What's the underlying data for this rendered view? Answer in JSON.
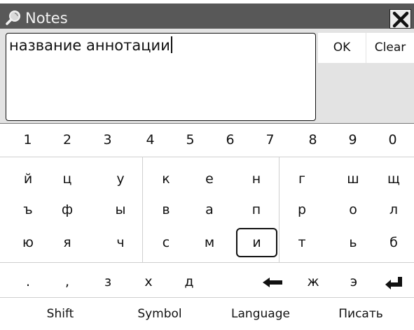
{
  "window": {
    "title": "Notes"
  },
  "editor": {
    "value": "название аннотации",
    "ok_label": "OK",
    "clear_label": "Clear"
  },
  "keyboard": {
    "number_row": [
      "1",
      "2",
      "3",
      "4",
      "5",
      "6",
      "7",
      "8",
      "9",
      "0"
    ],
    "row1": [
      "й",
      "ц",
      "у",
      "к",
      "е",
      "н",
      "г",
      "ш",
      "щ"
    ],
    "row2": [
      "ъ",
      "ф",
      "ы",
      "в",
      "а",
      "п",
      "р",
      "о",
      "л"
    ],
    "row3": [
      "ю",
      "я",
      "ч",
      "с",
      "м",
      "и",
      "т",
      "ь",
      "б"
    ],
    "row4": [
      ".",
      ",",
      "з",
      "х",
      "д",
      "ж",
      "э"
    ],
    "selected_key": "и",
    "bottom": {
      "shift": "Shift",
      "symbol": "Symbol",
      "language": "Language",
      "write": "Писать"
    }
  },
  "colors": {
    "titlebar": "#585858",
    "editor_background": "#e3e3e3",
    "keyboard_background": "#ffffff"
  },
  "icons": {
    "title": "magnifier-icon",
    "close": "close-icon",
    "backspace": "left-arrow-icon",
    "enter": "enter-icon"
  }
}
